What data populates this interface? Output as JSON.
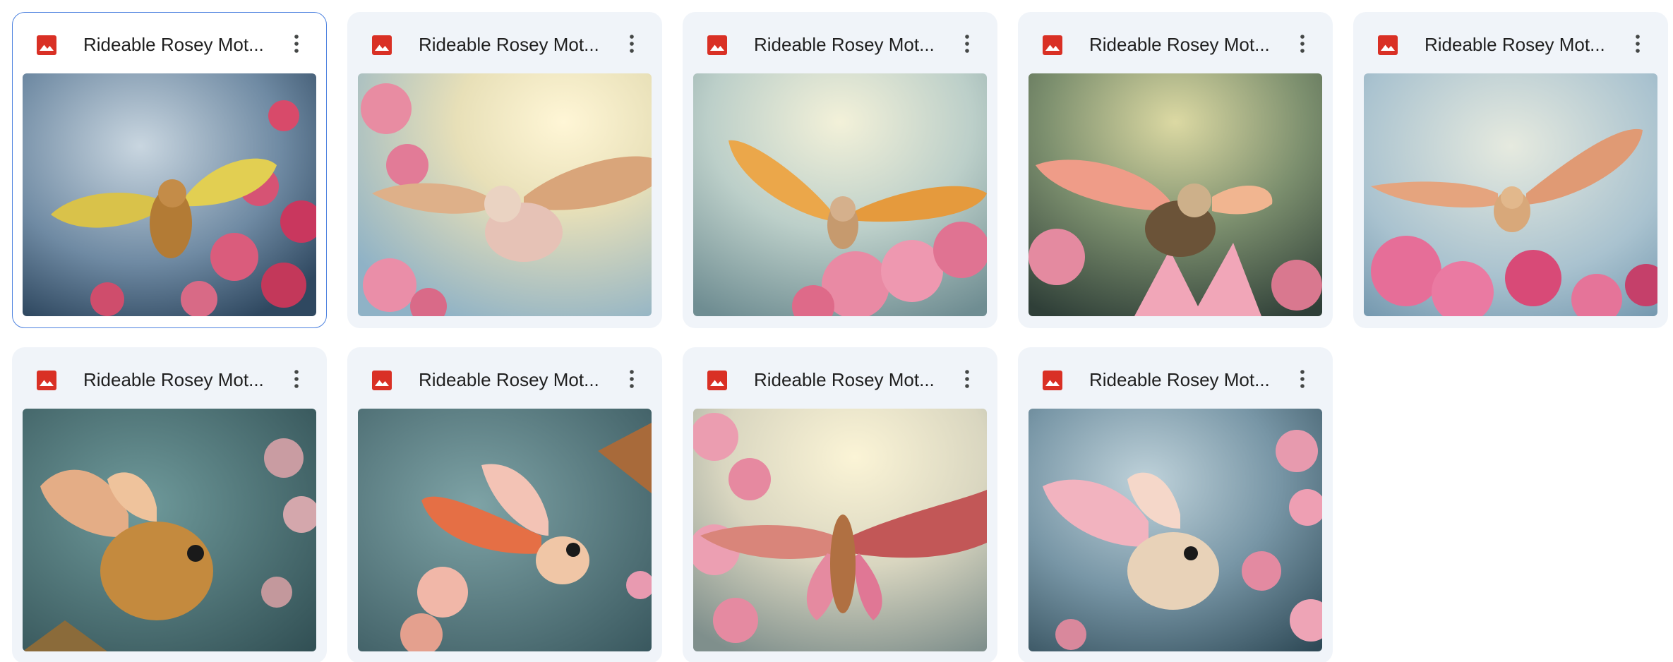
{
  "files": [
    {
      "name": "Rideable Rosey Mot...",
      "icon": "image-file-icon",
      "selected": true
    },
    {
      "name": "Rideable Rosey Mot...",
      "icon": "image-file-icon",
      "selected": false
    },
    {
      "name": "Rideable Rosey Mot...",
      "icon": "image-file-icon",
      "selected": false
    },
    {
      "name": "Rideable Rosey Mot...",
      "icon": "image-file-icon",
      "selected": false
    },
    {
      "name": "Rideable Rosey Mot...",
      "icon": "image-file-icon",
      "selected": false
    },
    {
      "name": "Rideable Rosey Mot...",
      "icon": "image-file-icon",
      "selected": false
    },
    {
      "name": "Rideable Rosey Mot...",
      "icon": "image-file-icon",
      "selected": false
    },
    {
      "name": "Rideable Rosey Mot...",
      "icon": "image-file-icon",
      "selected": false
    },
    {
      "name": "Rideable Rosey Mot...",
      "icon": "image-file-icon",
      "selected": false
    }
  ],
  "colors": {
    "card_bg": "#f0f4f9",
    "selected_border": "#4d82df",
    "image_icon": "#d93025",
    "title_text": "#1f1f1f",
    "more_icon": "#444746"
  }
}
